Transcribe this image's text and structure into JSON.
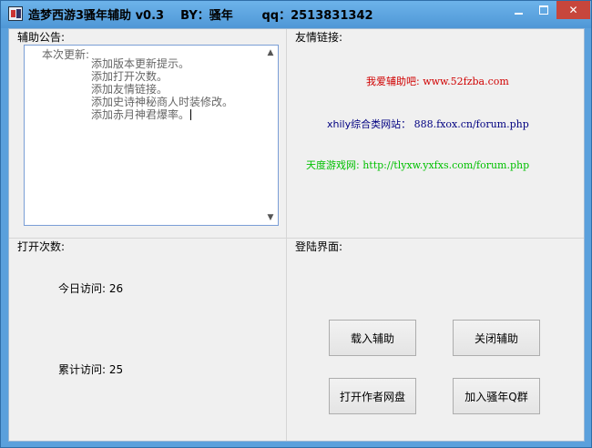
{
  "window": {
    "title": "造梦西游3骚年辅助 v0.3    BY：骚年       qq：2513831342",
    "close_glyph": "✕"
  },
  "notice_group": {
    "label": "辅助公告:",
    "header": "本次更新:",
    "lines": [
      "添加版本更新提示。",
      "添加打开次数。",
      "添加友情链接。",
      "添加史诗神秘商人时装修改。",
      "添加赤月神君爆率。"
    ]
  },
  "links_group": {
    "label": "友情链接:",
    "links": [
      {
        "name": "我爱辅助吧:",
        "url": "www.52fzba.com",
        "color": "#d00000"
      },
      {
        "name": "xhily综合类网站：",
        "url": "888.fxox.cn/forum.php",
        "color": "#000080"
      },
      {
        "name": "天度游戏网:",
        "url": "http://tlyxw.yxfxs.com/forum.php",
        "color": "#00c000"
      }
    ]
  },
  "open_count_group": {
    "label": "打开次数:",
    "today_label": "今日访问:",
    "today_value": "26",
    "total_label": "累计访问:",
    "total_value": "25"
  },
  "login_group": {
    "label": "登陆界面:",
    "buttons": {
      "load": "载入辅助",
      "close": "关闭辅助",
      "open_disk": "打开作者网盘",
      "join_group": "加入骚年Q群"
    }
  }
}
